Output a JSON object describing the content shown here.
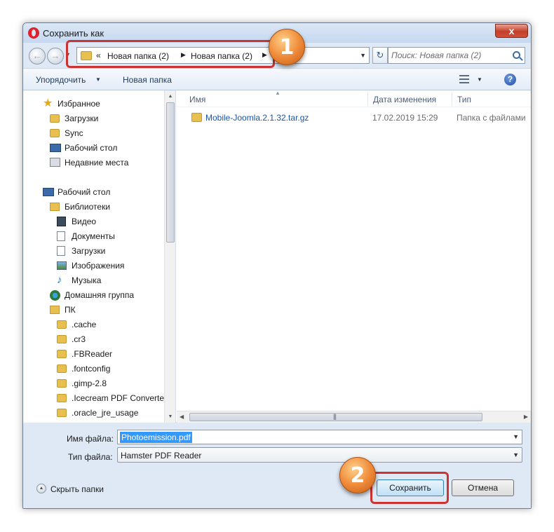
{
  "window": {
    "title": "Сохранить как",
    "close": "x"
  },
  "navbar": {
    "breadcrumb_prefix": "«",
    "path": [
      "Новая папка (2)",
      "Новая папка (2)"
    ],
    "search_placeholder": "Поиск: Новая папка (2)"
  },
  "toolbar": {
    "organize": "Упорядочить",
    "new_folder": "Новая папка"
  },
  "nav_pane": {
    "favorites": [
      {
        "label": "Избранное",
        "icon": "star-icon"
      },
      {
        "label": "Загрузки",
        "icon": "downloads-folder-icon"
      },
      {
        "label": "Sync",
        "icon": "folder-icon"
      },
      {
        "label": "Рабочий стол",
        "icon": "desktop-icon"
      },
      {
        "label": "Недавние места",
        "icon": "recent-places-icon"
      }
    ],
    "tree": [
      {
        "label": "Рабочий стол",
        "icon": "desktop-icon"
      },
      {
        "label": "Библиотеки",
        "icon": "libraries-icon"
      },
      {
        "label": "Видео",
        "icon": "video-icon"
      },
      {
        "label": "Документы",
        "icon": "documents-icon"
      },
      {
        "label": "Загрузки",
        "icon": "downloads-icon"
      },
      {
        "label": "Изображения",
        "icon": "pictures-icon"
      },
      {
        "label": "Музыка",
        "icon": "music-icon"
      },
      {
        "label": "Домашняя группа",
        "icon": "homegroup-icon"
      },
      {
        "label": "ПК",
        "icon": "pc-icon"
      },
      {
        "label": ".cache",
        "icon": "folder-icon"
      },
      {
        "label": ".cr3",
        "icon": "folder-icon"
      },
      {
        "label": ".FBReader",
        "icon": "folder-icon"
      },
      {
        "label": ".fontconfig",
        "icon": "folder-icon"
      },
      {
        "label": ".gimp-2.8",
        "icon": "folder-icon"
      },
      {
        "label": ".Icecream PDF Converter",
        "icon": "folder-icon"
      },
      {
        "label": ".oracle_jre_usage",
        "icon": "folder-icon"
      }
    ]
  },
  "file_list": {
    "columns": [
      "Имя",
      "Дата изменения",
      "Тип"
    ],
    "rows": [
      {
        "name": "Mobile-Joomla.2.1.32.tar.gz",
        "date": "17.02.2019 15:29",
        "type": "Папка с файлами"
      }
    ]
  },
  "form": {
    "filename_label": "Имя файла:",
    "filename_value": "Photoemission.pdf",
    "filetype_label": "Тип файла:",
    "filetype_value": "Hamster PDF Reader"
  },
  "footer": {
    "hide_folders": "Скрыть папки",
    "save": "Сохранить",
    "cancel": "Отмена"
  },
  "annotations": {
    "badge1": "1",
    "badge2": "2",
    "callout_color": "#cc3333"
  },
  "colors": {
    "accent": "#3399ff",
    "link": "#1a53a8",
    "badge": "#f08d3c"
  }
}
